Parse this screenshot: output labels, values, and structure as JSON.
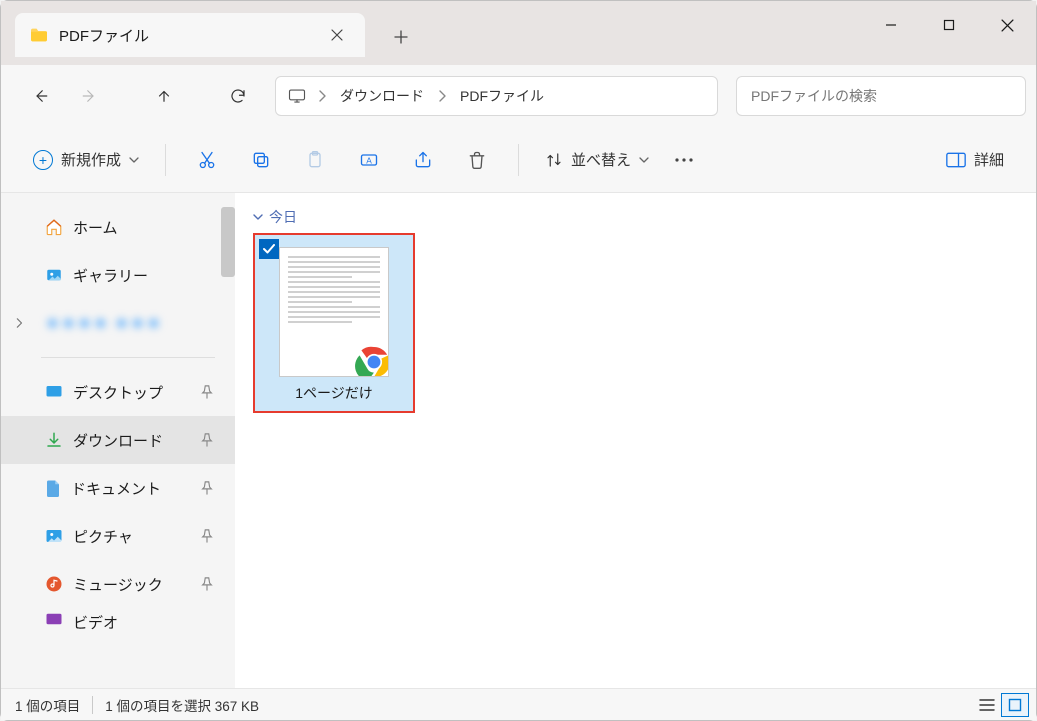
{
  "tab": {
    "title": "PDFファイル"
  },
  "breadcrumb": {
    "items": [
      "ダウンロード",
      "PDFファイル"
    ]
  },
  "search": {
    "placeholder": "PDFファイルの検索"
  },
  "toolbar": {
    "new_label": "新規作成",
    "sort_label": "並べ替え",
    "details_label": "詳細"
  },
  "sidebar": {
    "home": "ホーム",
    "gallery": "ギャラリー",
    "obscured": "＊＊＊＊ ＊＊＊",
    "pinned": {
      "desktop": "デスクトップ",
      "downloads": "ダウンロード",
      "documents": "ドキュメント",
      "pictures": "ピクチャ",
      "music": "ミュージック",
      "videos": "ビデオ"
    }
  },
  "content": {
    "group_today": "今日",
    "file_name": "1ページだけ"
  },
  "status": {
    "item_count": "1 個の項目",
    "selection": "1 個の項目を選択 367 KB"
  }
}
